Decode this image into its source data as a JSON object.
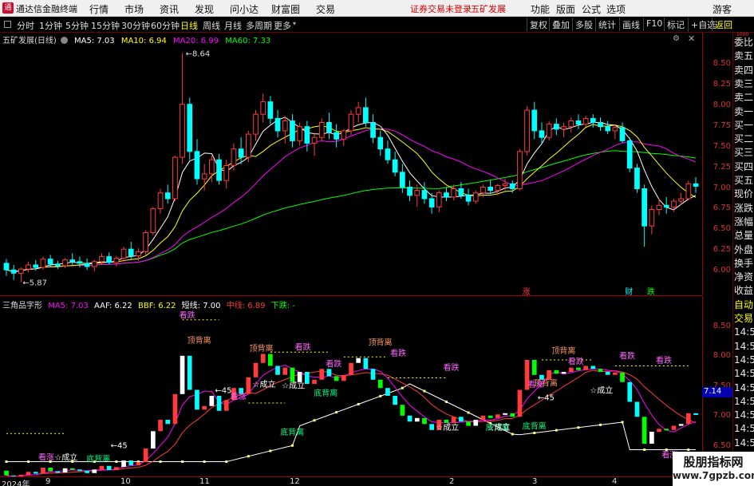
{
  "app": {
    "title": "通达信金融终端",
    "icon": "tdx-logo-icon"
  },
  "menu": [
    "行情",
    "市场",
    "资讯",
    "发现",
    "问小达",
    "财富圈",
    "交易"
  ],
  "status": {
    "trade_login": "证券交易未登录",
    "stock_name": "五矿发展"
  },
  "right_menu": [
    "功能",
    "版面",
    "公式",
    "选项"
  ],
  "guest_label": "游客",
  "periods": [
    {
      "label": "分时",
      "active": false
    },
    {
      "label": "1分钟",
      "active": false
    },
    {
      "label": "5分钟",
      "active": false
    },
    {
      "label": "15分钟",
      "active": false
    },
    {
      "label": "30分钟",
      "active": false
    },
    {
      "label": "60分钟",
      "active": false
    },
    {
      "label": "日线",
      "active": true
    },
    {
      "label": "周线",
      "active": false
    },
    {
      "label": "月线",
      "active": false
    },
    {
      "label": "多周期",
      "active": false
    },
    {
      "label": "更多",
      "active": false
    }
  ],
  "toolbar_buttons": [
    "复权",
    "叠加",
    "多股",
    "统计",
    "画线",
    "F10",
    "标记",
    "+自选",
    "返回"
  ],
  "side_panel": [
    "委比",
    "卖五",
    "卖四",
    "卖三",
    "卖二",
    "卖一",
    "买一",
    "买二",
    "买三",
    "买四",
    "买五",
    "现价",
    "涨跌",
    "涨幅",
    "总量",
    "外盘",
    "换手",
    "净资",
    "收益",
    "自动",
    "交易",
    "14:5",
    "14:5",
    "14:5",
    "14:5",
    "14:5",
    "14:5",
    "14:5",
    "14:5",
    "14:5",
    "14:5",
    "14:5",
    "14:5"
  ],
  "side_version": "1000",
  "main_legend": {
    "name": "五矿发展(日线)",
    "ma5": "MA5: 7.03",
    "ma10": "MA10: 6.94",
    "ma20": "MA20: 6.99",
    "ma60": "MA60: 7.33"
  },
  "colors": {
    "up": "#ff3b3b",
    "down": "#00ffff",
    "ma5": "#ffffff",
    "ma10": "#ffff00",
    "ma20": "#ff00ff",
    "ma60": "#00ff00"
  },
  "main_axis_ticks": [
    "8.50",
    "8.25",
    "8.00",
    "7.75",
    "7.50",
    "7.25",
    "7.00",
    "6.75",
    "6.50",
    "6.25",
    "6.00"
  ],
  "main_annotations": {
    "high": "8.64",
    "low": "5.87",
    "flag_up": "涨",
    "flag_cai": "财",
    "flag_down": "跌"
  },
  "ind_legend": {
    "name": "三角品字形",
    "ma5": "MA5: 7.03",
    "aaf": "AAF: 6.22",
    "bbf": "BBF: 6.22",
    "short": "短线: 7.00",
    "mid": "中线: 6.89",
    "down": "下跌: -"
  },
  "ind_axis_ticks": [
    "8.50",
    "8.00",
    "7.50",
    "7.00",
    "6.50"
  ],
  "current_price_tag": "7.14",
  "ind_labels": {
    "kandie": "看跌",
    "kanzhang": "看涨",
    "dingbeili": "顶背离",
    "dibeili": "底背离",
    "chengli": "☆成立",
    "num45": "45"
  },
  "date_axis": [
    "2024年",
    "9",
    "10",
    "11",
    "12",
    "2",
    "3",
    "4"
  ],
  "watermark": {
    "line1": "股朋指标网",
    "line2": "www.7gpzb.com"
  },
  "chart_data": {
    "type": "candlestick",
    "title": "五矿发展(日线)",
    "ylim": [
      5.8,
      8.75
    ],
    "y_ticks": [
      6.0,
      6.25,
      6.5,
      6.75,
      7.0,
      7.25,
      7.5,
      7.75,
      8.0,
      8.25,
      8.5
    ],
    "ohlc": [
      [
        6.1,
        6.15,
        5.95,
        6.02
      ],
      [
        6.02,
        6.08,
        5.9,
        5.98
      ],
      [
        5.98,
        6.05,
        5.87,
        6.03
      ],
      [
        6.03,
        6.12,
        5.99,
        6.08
      ],
      [
        6.08,
        6.14,
        6.01,
        6.05
      ],
      [
        6.05,
        6.18,
        6.02,
        6.15
      ],
      [
        6.15,
        6.2,
        6.06,
        6.09
      ],
      [
        6.09,
        6.13,
        6.03,
        6.07
      ],
      [
        6.07,
        6.16,
        6.04,
        6.14
      ],
      [
        6.14,
        6.22,
        6.08,
        6.12
      ],
      [
        6.12,
        6.18,
        6.05,
        6.1
      ],
      [
        6.1,
        6.16,
        6.02,
        6.06
      ],
      [
        6.06,
        6.14,
        6.0,
        6.12
      ],
      [
        6.12,
        6.22,
        6.08,
        6.18
      ],
      [
        6.18,
        6.23,
        6.09,
        6.11
      ],
      [
        6.11,
        6.19,
        6.06,
        6.16
      ],
      [
        6.16,
        6.3,
        6.12,
        6.27
      ],
      [
        6.27,
        6.36,
        6.15,
        6.19
      ],
      [
        6.19,
        6.28,
        6.13,
        6.24
      ],
      [
        6.24,
        6.5,
        6.2,
        6.47
      ],
      [
        6.47,
        6.78,
        6.44,
        6.76
      ],
      [
        6.76,
        7.0,
        6.7,
        6.95
      ],
      [
        6.95,
        7.05,
        6.82,
        6.88
      ],
      [
        6.88,
        7.4,
        6.85,
        7.38
      ],
      [
        7.38,
        8.64,
        7.3,
        8.02
      ],
      [
        8.02,
        8.1,
        7.35,
        7.45
      ],
      [
        7.45,
        7.6,
        7.05,
        7.12
      ],
      [
        7.12,
        7.3,
        6.98,
        7.18
      ],
      [
        7.18,
        7.4,
        7.08,
        7.35
      ],
      [
        7.35,
        7.42,
        7.05,
        7.1
      ],
      [
        7.1,
        7.35,
        7.0,
        7.28
      ],
      [
        7.28,
        7.55,
        7.22,
        7.48
      ],
      [
        7.48,
        7.62,
        7.3,
        7.38
      ],
      [
        7.38,
        7.7,
        7.32,
        7.66
      ],
      [
        7.66,
        7.95,
        7.58,
        7.9
      ],
      [
        7.9,
        8.15,
        7.8,
        8.05
      ],
      [
        8.05,
        8.12,
        7.78,
        7.85
      ],
      [
        7.85,
        7.95,
        7.62,
        7.7
      ],
      [
        7.7,
        7.88,
        7.55,
        7.82
      ],
      [
        7.82,
        7.9,
        7.5,
        7.58
      ],
      [
        7.58,
        7.8,
        7.52,
        7.75
      ],
      [
        7.75,
        7.82,
        7.45,
        7.55
      ],
      [
        7.55,
        7.68,
        7.4,
        7.62
      ],
      [
        7.62,
        7.85,
        7.58,
        7.8
      ],
      [
        7.8,
        7.92,
        7.6,
        7.68
      ],
      [
        7.68,
        7.78,
        7.5,
        7.6
      ],
      [
        7.6,
        7.72,
        7.52,
        7.7
      ],
      [
        7.7,
        7.95,
        7.65,
        7.9
      ],
      [
        7.9,
        8.05,
        7.8,
        7.98
      ],
      [
        7.98,
        8.1,
        7.75,
        7.8
      ],
      [
        7.8,
        7.9,
        7.55,
        7.62
      ],
      [
        7.62,
        7.7,
        7.4,
        7.48
      ],
      [
        7.48,
        7.58,
        7.3,
        7.35
      ],
      [
        7.35,
        7.45,
        7.15,
        7.2
      ],
      [
        7.2,
        7.3,
        6.95,
        7.02
      ],
      [
        7.02,
        7.1,
        6.85,
        6.92
      ],
      [
        6.92,
        7.05,
        6.78,
        6.98
      ],
      [
        6.98,
        7.08,
        6.82,
        6.88
      ],
      [
        6.88,
        6.95,
        6.7,
        6.78
      ],
      [
        6.78,
        6.98,
        6.72,
        6.95
      ],
      [
        6.95,
        7.02,
        6.85,
        6.9
      ],
      [
        6.9,
        7.05,
        6.86,
        7.0
      ],
      [
        7.0,
        7.08,
        6.88,
        6.92
      ],
      [
        6.92,
        7.0,
        6.8,
        6.85
      ],
      [
        6.85,
        6.98,
        6.82,
        6.95
      ],
      [
        6.95,
        7.05,
        6.9,
        7.02
      ],
      [
        7.02,
        7.1,
        6.95,
        6.98
      ],
      [
        6.98,
        7.06,
        6.92,
        7.04
      ],
      [
        7.04,
        7.12,
        6.98,
        7.06
      ],
      [
        7.06,
        7.1,
        6.95,
        7.0
      ],
      [
        7.0,
        7.48,
        6.98,
        7.45
      ],
      [
        7.45,
        8.0,
        7.4,
        7.95
      ],
      [
        7.95,
        8.05,
        7.6,
        7.7
      ],
      [
        7.7,
        7.8,
        7.55,
        7.62
      ],
      [
        7.62,
        7.82,
        7.58,
        7.78
      ],
      [
        7.78,
        7.85,
        7.65,
        7.72
      ],
      [
        7.72,
        7.8,
        7.62,
        7.75
      ],
      [
        7.75,
        7.86,
        7.68,
        7.82
      ],
      [
        7.82,
        7.9,
        7.72,
        7.78
      ],
      [
        7.78,
        7.88,
        7.75,
        7.85
      ],
      [
        7.85,
        7.9,
        7.74,
        7.8
      ],
      [
        7.8,
        7.86,
        7.7,
        7.75
      ],
      [
        7.75,
        7.82,
        7.66,
        7.7
      ],
      [
        7.7,
        7.78,
        7.6,
        7.74
      ],
      [
        7.74,
        7.8,
        7.55,
        7.58
      ],
      [
        7.58,
        7.62,
        7.2,
        7.25
      ],
      [
        7.25,
        7.3,
        6.95,
        7.0
      ],
      [
        7.0,
        7.05,
        6.3,
        6.55
      ],
      [
        6.55,
        6.8,
        6.45,
        6.75
      ],
      [
        6.75,
        6.88,
        6.68,
        6.8
      ],
      [
        6.8,
        6.9,
        6.7,
        6.78
      ],
      [
        6.78,
        6.88,
        6.72,
        6.85
      ],
      [
        6.85,
        6.95,
        6.8,
        6.88
      ],
      [
        6.88,
        7.1,
        6.86,
        7.06
      ],
      [
        7.06,
        7.14,
        6.95,
        7.03
      ]
    ],
    "series": [
      {
        "name": "MA5",
        "color": "#ffffff"
      },
      {
        "name": "MA10",
        "color": "#ffff00"
      },
      {
        "name": "MA20",
        "color": "#ff00ff"
      },
      {
        "name": "MA60",
        "color": "#00ff00"
      }
    ]
  }
}
